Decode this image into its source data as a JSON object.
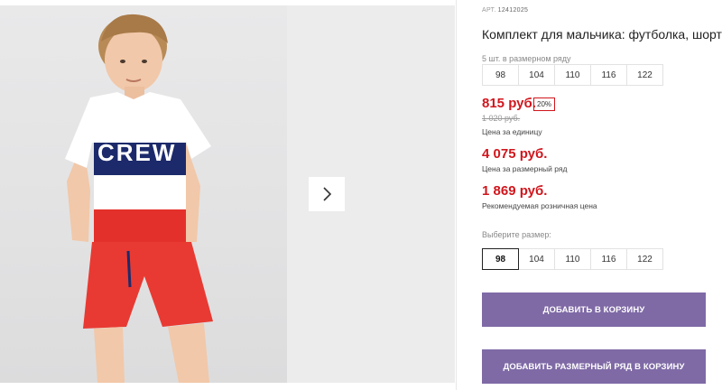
{
  "product": {
    "sku_label": "АРТ.",
    "sku_number": "12412025",
    "title": "Комплект для мальчика: футболка, шорты",
    "print_text": "CREW"
  },
  "pack": {
    "label": "5 шт. в размерном ряду",
    "sizes": [
      "98",
      "104",
      "110",
      "116",
      "122"
    ]
  },
  "pricing": {
    "unit_price": "815 руб.",
    "discount": "20%",
    "old_price": "1 020 руб.",
    "unit_caption": "Цена за единицу",
    "pack_price": "4 075 руб.",
    "pack_caption": "Цена за размерный ряд",
    "retail_price": "1 869 руб.",
    "retail_caption": "Рекомендуемая розничная цена"
  },
  "size_picker": {
    "label": "Выберите размер:",
    "sizes": [
      "98",
      "104",
      "110",
      "116",
      "122"
    ],
    "selected": "98"
  },
  "actions": {
    "add_to_cart": "ДОБАВИТЬ В КОРЗИНУ",
    "add_pack_to_cart": "ДОБАВИТЬ РАЗМЕРНЫЙ РЯД В КОРЗИНУ"
  },
  "colors": {
    "price_red": "#d0161d",
    "button_purple": "#7f6aa6"
  }
}
